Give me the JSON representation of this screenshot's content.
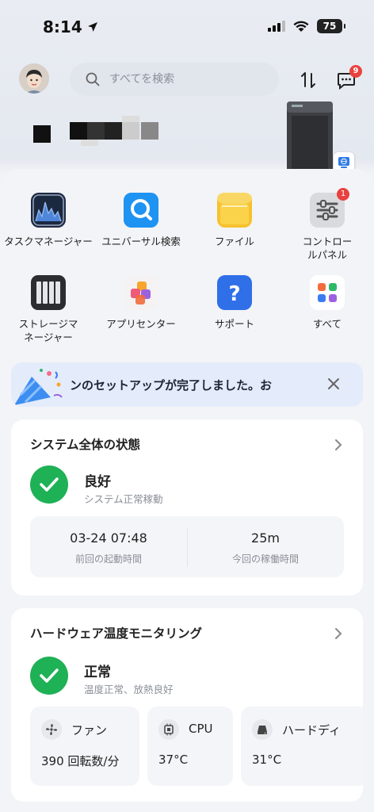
{
  "status_bar": {
    "time": "8:14",
    "battery": "75"
  },
  "header": {
    "search_placeholder": "すべてを検索",
    "message_badge": "9"
  },
  "apps": [
    {
      "label": "タスクマネージャー",
      "icon": "task-manager-icon",
      "badge": ""
    },
    {
      "label": "ユニバーサル検索",
      "icon": "universal-search-icon",
      "badge": ""
    },
    {
      "label": "ファイル",
      "icon": "folder-icon",
      "badge": ""
    },
    {
      "label": "コントロールパネル",
      "icon": "control-panel-icon",
      "badge": "1"
    },
    {
      "label": "ストレージマネージャー",
      "icon": "storage-manager-icon",
      "badge": ""
    },
    {
      "label": "アプリセンター",
      "icon": "app-center-icon",
      "badge": ""
    },
    {
      "label": "サポート",
      "icon": "support-icon",
      "badge": ""
    },
    {
      "label": "すべて",
      "icon": "all-apps-icon",
      "badge": ""
    }
  ],
  "banner": {
    "text": "ンのセットアップが完了しました。お"
  },
  "system_card": {
    "title": "システム全体の状態",
    "status": "良好",
    "status_sub": "システム正常稼動",
    "stats": [
      {
        "value": "03-24 07:48",
        "label": "前回の起動時間"
      },
      {
        "value": "25m",
        "label": "今回の稼働時間"
      }
    ]
  },
  "hardware_card": {
    "title": "ハードウェア温度モニタリング",
    "status": "正常",
    "status_sub": "温度正常、放熱良好",
    "items": [
      {
        "name": "ファン",
        "value": "390 回転数/分",
        "icon": "fan-icon"
      },
      {
        "name": "CPU",
        "value": "37°C",
        "icon": "cpu-icon"
      },
      {
        "name": "ハードディ",
        "value": "31°C",
        "icon": "disk-icon"
      }
    ]
  },
  "colors": {
    "accent_green": "#1fb155",
    "badge_red": "#e8423f",
    "banner_bg": "#e4ecfb"
  }
}
